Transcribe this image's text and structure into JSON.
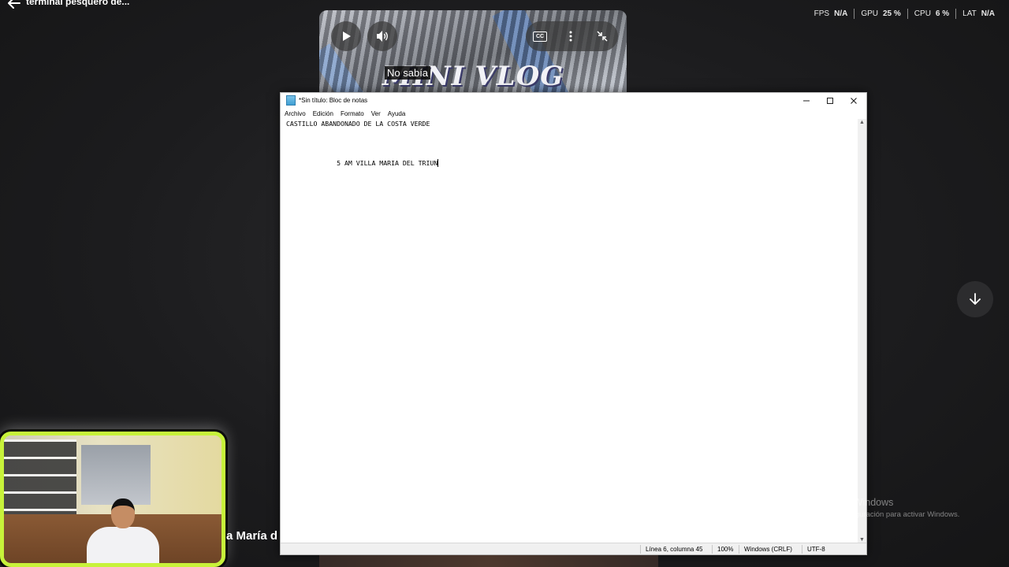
{
  "header": {
    "title": "terminal pesquero de...",
    "stats": [
      {
        "label": "FPS",
        "value": "N/A"
      },
      {
        "label": "GPU",
        "value": "25 %"
      },
      {
        "label": "CPU",
        "value": "6 %"
      },
      {
        "label": "LAT",
        "value": "N/A"
      }
    ]
  },
  "video": {
    "overlay_text": "MINI VLOG",
    "caption": "No sabía",
    "cc_label": "CC"
  },
  "notepad": {
    "title": "*Sin título: Bloc de notas",
    "menu": [
      "Archivo",
      "Edición",
      "Formato",
      "Ver",
      "Ayuda"
    ],
    "lines": [
      "CASTILLO ABANDONADO DE LA COSTA VERDE",
      "",
      "",
      "",
      "",
      "             5 AM VILLA MARIA DEL TRIUN"
    ],
    "status": {
      "position": "Línea 6, columna 45",
      "zoom": "100%",
      "line_ending": "Windows (CRLF)",
      "encoding": "UTF-8"
    }
  },
  "watermark": {
    "title": "Activar Windows",
    "subtitle": "Ve a Configuración para activar Windows."
  },
  "stream": {
    "name_partial": "a María d"
  }
}
